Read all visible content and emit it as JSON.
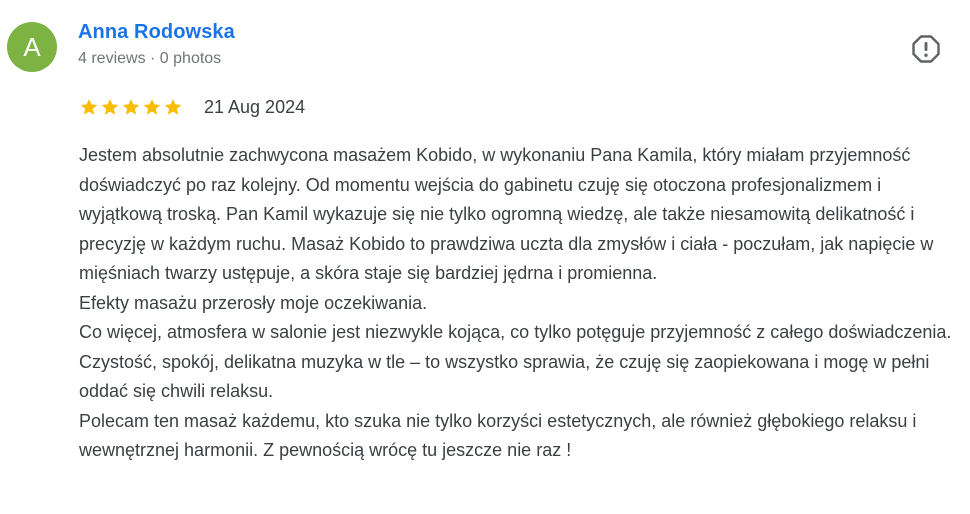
{
  "author": {
    "initial": "A",
    "name": "Anna Rodowska",
    "meta": "4 reviews · 0 photos",
    "avatar_color": "#7cb342"
  },
  "report_icon": "report-exclamation-octagon-icon",
  "rating": {
    "stars": 5,
    "max": 5,
    "star_color": "#fbbc04",
    "date": "21 Aug 2024"
  },
  "review": {
    "paragraphs": [
      "Jestem absolutnie zachwycona masażem Kobido, w wykonaniu Pana Kamila, który miałam przyjemność doświadczyć po raz kolejny. Od momentu wejścia do gabinetu czuję się otoczona profesjonalizmem i wyjątkową troską. Pan Kamil wykazuje się nie tylko ogromną wiedzę, ale także niesamowitą delikatność i precyzję w każdym ruchu. Masaż Kobido to prawdziwa uczta dla zmysłów i ciała - poczułam, jak napięcie w mięśniach twarzy ustępuje, a skóra staje się bardziej jędrna i promienna.",
      "Efekty masażu przerosły moje oczekiwania.",
      "Co więcej, atmosfera w salonie jest niezwykle kojąca, co tylko potęguje przyjemność z całego doświadczenia. Czystość, spokój, delikatna muzyka w tle – to wszystko sprawia, że czuję się zaopiekowana i mogę w pełni oddać się chwili relaksu.",
      "Polecam ten masaż każdemu, kto szuka nie tylko korzyści estetycznych, ale również głębokiego relaksu i wewnętrznej harmonii. Z pewnością wrócę tu jeszcze nie raz !"
    ]
  }
}
